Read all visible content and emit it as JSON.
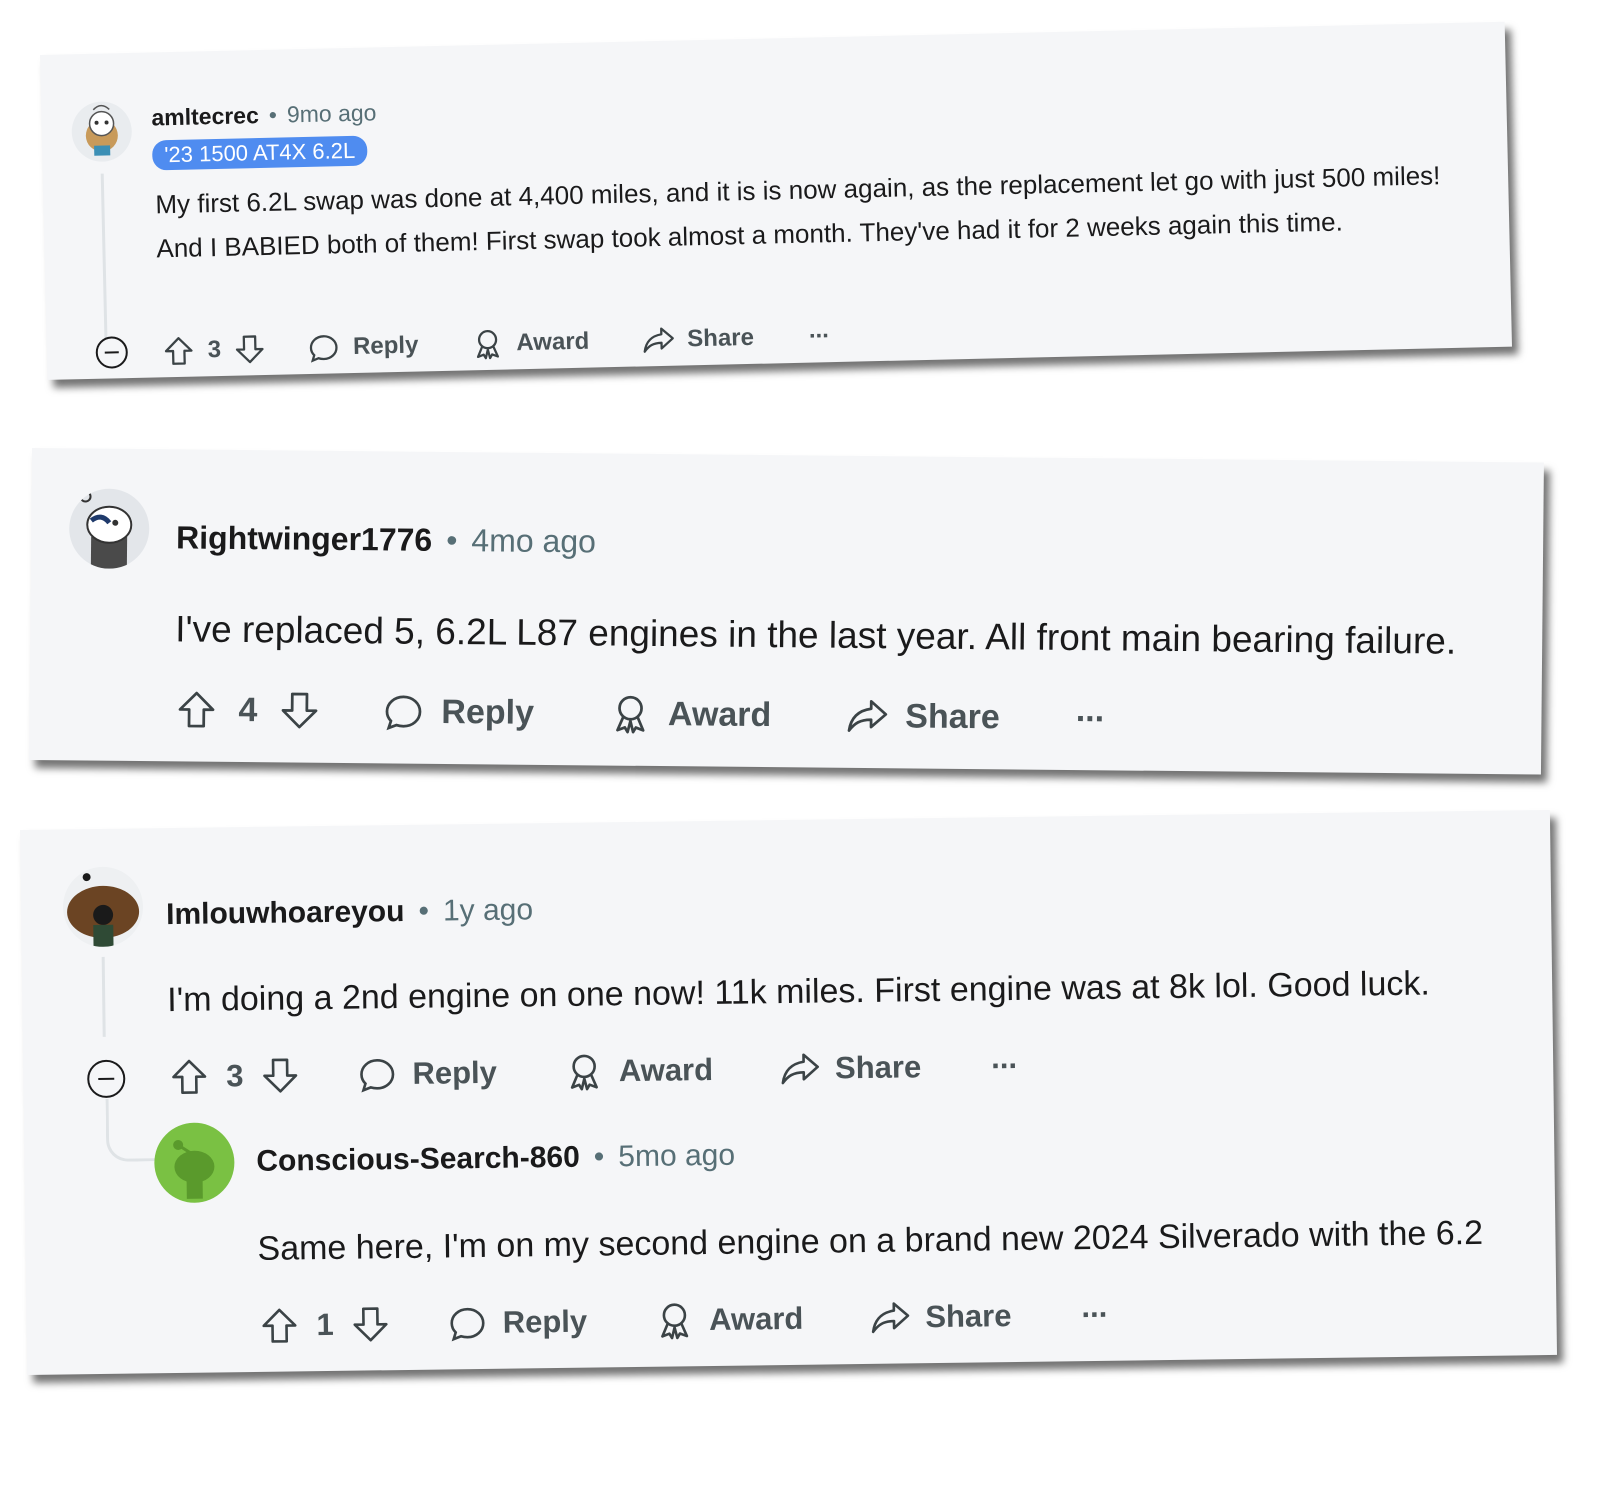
{
  "comments": [
    {
      "username": "amltecrec",
      "time": "9mo ago",
      "flair": "'23 1500 AT4X 6.2L",
      "body": "My first 6.2L swap was done at 4,400 miles, and it is is now again, as the replacement let go with just 500 miles! And I BABIED both of them! First swap took almost a month. They've had it for 2 weeks again this time.",
      "votes": "3",
      "reply_label": "Reply",
      "award_label": "Award",
      "share_label": "Share",
      "more_label": "..."
    },
    {
      "username": "Rightwinger1776",
      "time": "4mo ago",
      "body": "I've replaced 5, 6.2L L87 engines in the last year. All front main bearing failure.",
      "votes": "4",
      "reply_label": "Reply",
      "award_label": "Award",
      "share_label": "Share",
      "more_label": "..."
    },
    {
      "username": "Imlouwhoareyou",
      "time": "1y ago",
      "body": "I'm doing a 2nd engine on one now! 11k miles. First engine was at 8k lol. Good luck.",
      "votes": "3",
      "reply_label": "Reply",
      "award_label": "Award",
      "share_label": "Share",
      "more_label": "..."
    },
    {
      "username": "Conscious-Search-860",
      "time": "5mo ago",
      "body": "Same here, I'm on my second engine on a brand new 2024 Silverado with the 6.2",
      "votes": "1",
      "reply_label": "Reply",
      "award_label": "Award",
      "share_label": "Share",
      "more_label": "..."
    }
  ],
  "separator": "•",
  "colors": {
    "card_bg": "#f5f6f8",
    "flair_bg": "#4f8cf0",
    "meta_gray": "#576f76",
    "avatar_green": "#7ac143"
  }
}
